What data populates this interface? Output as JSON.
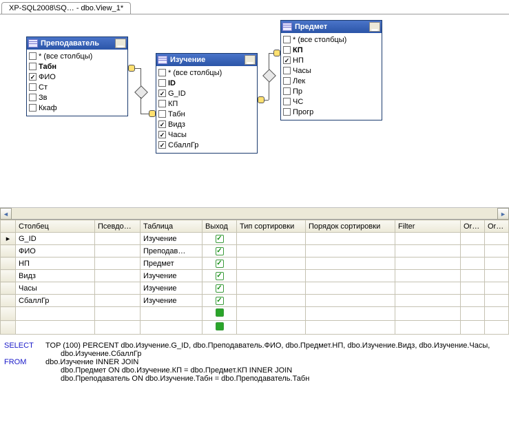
{
  "tab_title": "XP-SQL2008\\SQ… - dbo.View_1*",
  "tables": {
    "t1": {
      "title": "Преподаватель",
      "cols": [
        {
          "label": "* (все столбцы)",
          "checked": false,
          "bold": false
        },
        {
          "label": "Табн",
          "checked": false,
          "bold": true
        },
        {
          "label": "ФИО",
          "checked": true,
          "bold": false
        },
        {
          "label": "Ст",
          "checked": false,
          "bold": false
        },
        {
          "label": "Зв",
          "checked": false,
          "bold": false
        },
        {
          "label": "Ккаф",
          "checked": false,
          "bold": false
        }
      ]
    },
    "t2": {
      "title": "Изучение",
      "cols": [
        {
          "label": "* (все столбцы)",
          "checked": false,
          "bold": false
        },
        {
          "label": "ID",
          "checked": false,
          "bold": true
        },
        {
          "label": "G_ID",
          "checked": true,
          "bold": false
        },
        {
          "label": "КП",
          "checked": false,
          "bold": false
        },
        {
          "label": "Табн",
          "checked": false,
          "bold": false
        },
        {
          "label": "Видз",
          "checked": true,
          "bold": false
        },
        {
          "label": "Часы",
          "checked": true,
          "bold": false
        },
        {
          "label": "СбаллГр",
          "checked": true,
          "bold": false
        }
      ]
    },
    "t3": {
      "title": "Предмет",
      "cols": [
        {
          "label": "* (все столбцы)",
          "checked": false,
          "bold": false
        },
        {
          "label": "КП",
          "checked": false,
          "bold": true
        },
        {
          "label": "НП",
          "checked": true,
          "bold": false
        },
        {
          "label": "Часы",
          "checked": false,
          "bold": false
        },
        {
          "label": "Лек",
          "checked": false,
          "bold": false
        },
        {
          "label": "Пр",
          "checked": false,
          "bold": false
        },
        {
          "label": "ЧС",
          "checked": false,
          "bold": false
        },
        {
          "label": "Прогр",
          "checked": false,
          "bold": false
        }
      ]
    }
  },
  "grid": {
    "headers": {
      "column": "Столбец",
      "alias": "Псевдо…",
      "table": "Таблица",
      "output": "Выход",
      "sorttype": "Тип сортировки",
      "sortorder": "Порядок сортировки",
      "filter": "Filter",
      "or1": "Or…",
      "or2": "Or…"
    },
    "rows": [
      {
        "col": "G_ID",
        "table": "Изучение",
        "out": "tick",
        "current": true
      },
      {
        "col": "ФИО",
        "table": "Преподав…",
        "out": "tick"
      },
      {
        "col": "НП",
        "table": "Предмет",
        "out": "tick"
      },
      {
        "col": "Видз",
        "table": "Изучение",
        "out": "tick"
      },
      {
        "col": "Часы",
        "table": "Изучение",
        "out": "tick"
      },
      {
        "col": "СбаллГр",
        "table": "Изучение",
        "out": "tick"
      },
      {
        "col": "",
        "table": "",
        "out": "fill"
      },
      {
        "col": "",
        "table": "",
        "out": "fill"
      }
    ]
  },
  "sql": {
    "select_kw": "SELECT",
    "select_txt": "TOP (100) PERCENT dbo.Изучение.G_ID, dbo.Преподаватель.ФИО, dbo.Предмет.НП, dbo.Изучение.Видз, dbo.Изучение.Часы,",
    "select_txt2": "dbo.Изучение.СбаллГр",
    "from_kw": "FROM",
    "from_txt": "dbo.Изучение INNER JOIN",
    "from_txt2": "dbo.Предмет ON dbo.Изучение.КП = dbo.Предмет.КП INNER JOIN",
    "from_txt3": "dbo.Преподаватель ON dbo.Изучение.Табн = dbo.Преподаватель.Табн"
  }
}
